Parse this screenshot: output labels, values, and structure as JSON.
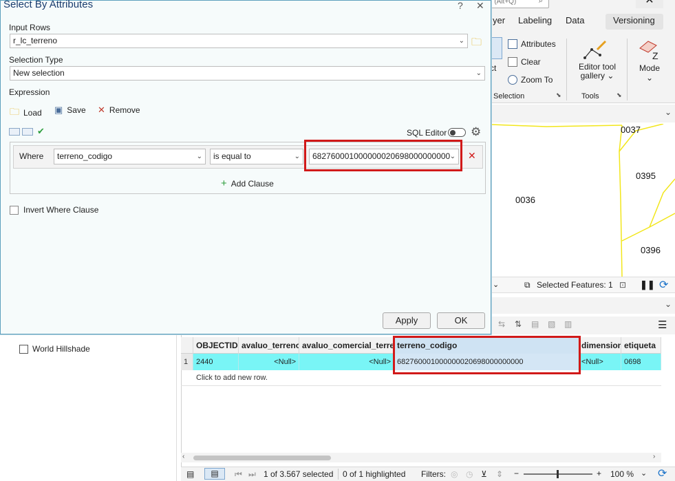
{
  "dialog": {
    "title": "Select By Attributes",
    "help": "?",
    "close": "✕",
    "input_rows_label": "Input Rows",
    "input_rows_value": "r_lc_terreno",
    "selection_type_label": "Selection Type",
    "selection_type_value": "New selection",
    "expression_label": "Expression",
    "load": "Load",
    "save": "Save",
    "remove": "Remove",
    "sql_editor": "SQL Editor",
    "where": "Where",
    "field": "terreno_codigo",
    "operator": "is equal to",
    "value": "682760001000000020698000000000",
    "add_clause": "Add Clause",
    "invert": "Invert Where Clause",
    "apply": "Apply",
    "ok": "OK"
  },
  "ribbon": {
    "search_fragment": "ch (Alt+Q)",
    "tabs": [
      "yer",
      "Labeling",
      "Data",
      "Versioning"
    ],
    "attributes": "Attributes",
    "clear": "Clear",
    "zoom_to": "Zoom To",
    "select_fragment": "ct",
    "selection_group": "Selection",
    "editor_tool_gallery_1": "Editor tool",
    "editor_tool_gallery_2": "gallery",
    "tools_group": "Tools",
    "mode": "Mode"
  },
  "map": {
    "labels": [
      "0037",
      "0395",
      "0036",
      "0396"
    ],
    "selected_features": "Selected Features: 1"
  },
  "table": {
    "columns": [
      "OBJECTID *",
      "avaluo_terreno",
      "avaluo_comercial_terreno",
      "terreno_codigo",
      "dimension",
      "etiqueta"
    ],
    "row_number": "1",
    "row": [
      "2440",
      "<Null>",
      "<Null>",
      "682760001000000020698000000000",
      "<Null>",
      "0698"
    ],
    "add_row": "Click to add new row.",
    "status_selected": "1 of 3.567 selected",
    "status_highlighted": "0 of 1 highlighted",
    "filters": "Filters:",
    "zoom": "100 %"
  },
  "left_panel": {
    "layer": "World Hillshade"
  },
  "colors": {
    "accent": "#1a3c6e",
    "highlight_row": "#79f5f6",
    "annotation_red": "#d11919",
    "parcel_lines": "#f2e61a"
  }
}
